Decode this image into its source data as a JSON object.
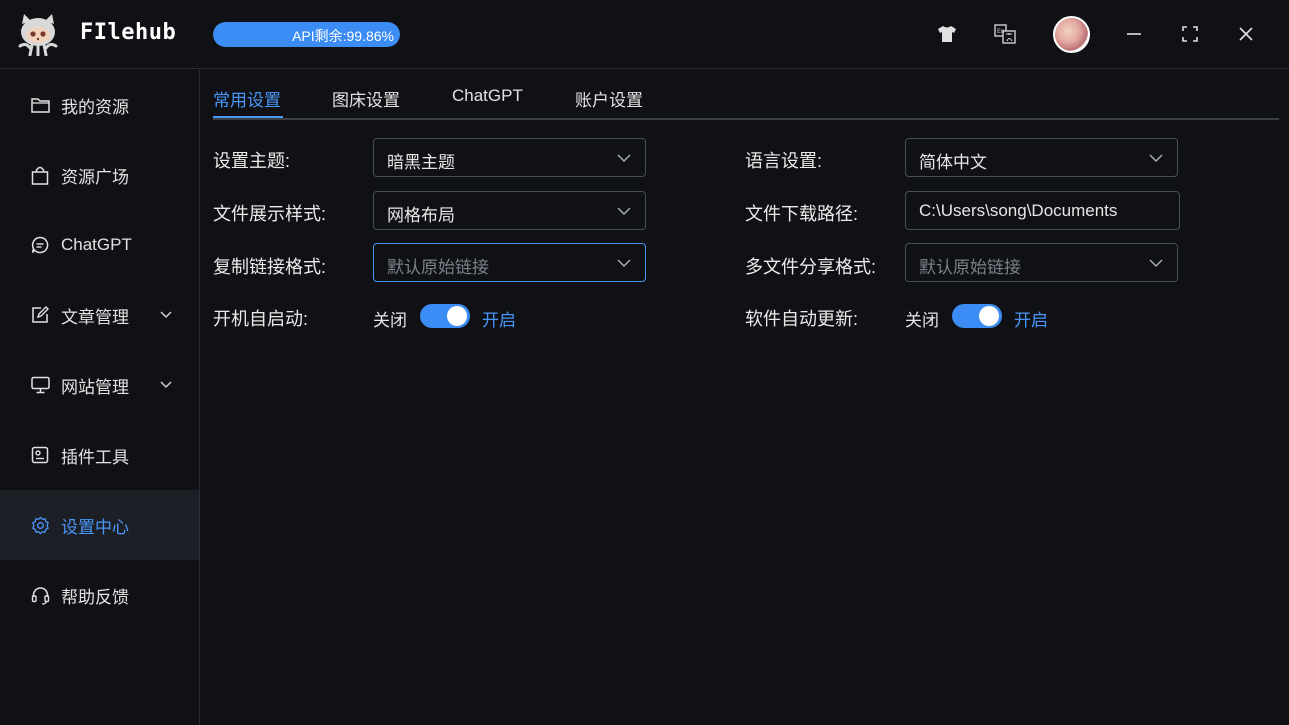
{
  "app": {
    "name": "FIlehub"
  },
  "api": {
    "label": "API剩余:99.86%",
    "remaining_percent": 99.86
  },
  "titlebar": {
    "icons": [
      "tshirt-icon",
      "translate-icon",
      "avatar",
      "minimize-icon",
      "maximize-icon",
      "close-icon"
    ]
  },
  "sidebar": {
    "items": [
      {
        "label": "我的资源",
        "icon": "folder-icon"
      },
      {
        "label": "资源广场",
        "icon": "shopping-bag-icon"
      },
      {
        "label": "ChatGPT",
        "icon": "chat-icon"
      },
      {
        "label": "文章管理",
        "icon": "edit-icon",
        "expandable": true
      },
      {
        "label": "网站管理",
        "icon": "monitor-icon",
        "expandable": true
      },
      {
        "label": "插件工具",
        "icon": "plugin-icon"
      },
      {
        "label": "设置中心",
        "icon": "gear-icon",
        "active": true
      },
      {
        "label": "帮助反馈",
        "icon": "headset-icon"
      }
    ]
  },
  "tabs": [
    {
      "label": "常用设置",
      "active": true
    },
    {
      "label": "图床设置"
    },
    {
      "label": "ChatGPT"
    },
    {
      "label": "账户设置"
    }
  ],
  "settings": {
    "theme": {
      "label": "设置主题:",
      "value": "暗黑主题"
    },
    "language": {
      "label": "语言设置:",
      "value": "简体中文"
    },
    "file_display": {
      "label": "文件展示样式:",
      "value": "网格布局"
    },
    "download_path": {
      "label": "文件下载路径:",
      "value": "C:\\Users\\song\\Documents"
    },
    "copy_link": {
      "label": "复制链接格式:",
      "placeholder": "默认原始链接"
    },
    "multi_share": {
      "label": "多文件分享格式:",
      "placeholder": "默认原始链接"
    },
    "autostart": {
      "label": "开机自启动:",
      "off_label": "关闭",
      "on_label": "开启",
      "enabled": true
    },
    "autoupdate": {
      "label": "软件自动更新:",
      "off_label": "关闭",
      "on_label": "开启",
      "enabled": true
    }
  },
  "colors": {
    "accent": "#4a96f7",
    "background": "#0f1115",
    "sidebar_active": "#1c1f25"
  }
}
